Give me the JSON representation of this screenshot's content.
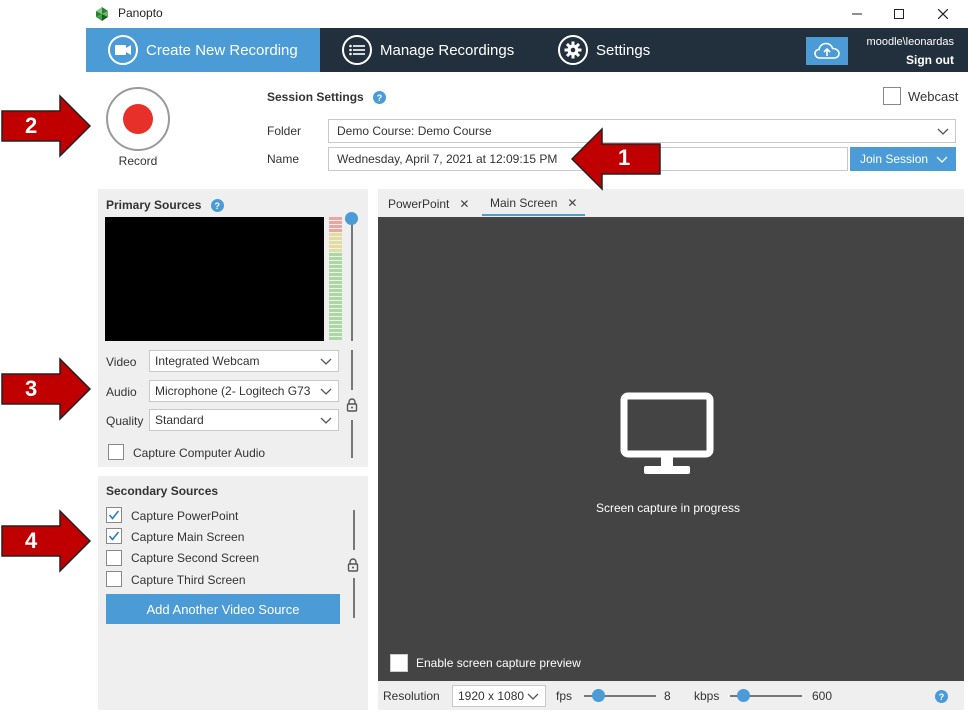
{
  "window": {
    "title": "Panopto"
  },
  "nav": {
    "tabs": [
      {
        "label": "Create New Recording",
        "icon": "video-camera-icon",
        "active": true
      },
      {
        "label": "Manage Recordings",
        "icon": "list-icon",
        "active": false
      },
      {
        "label": "Settings",
        "icon": "gear-icon",
        "active": false
      }
    ],
    "username": "moodle\\leonardas",
    "signout_label": "Sign out"
  },
  "record": {
    "label": "Record"
  },
  "session": {
    "title": "Session Settings",
    "help": "?",
    "webcast_label": "Webcast",
    "webcast_checked": false,
    "folder_label": "Folder",
    "folder_value": "Demo Course: Demo Course",
    "name_label": "Name",
    "name_value": "Wednesday, April 7, 2021 at 12:09:15 PM",
    "join_label": "Join Session"
  },
  "primary": {
    "title": "Primary Sources",
    "help": "?",
    "video_label": "Video",
    "video_value": "Integrated Webcam",
    "audio_label": "Audio",
    "audio_value": "Microphone (2- Logitech G73",
    "quality_label": "Quality",
    "quality_value": "Standard",
    "capture_audio_label": "Capture Computer Audio",
    "capture_audio_checked": false
  },
  "secondary": {
    "title": "Secondary Sources",
    "options": [
      {
        "label": "Capture PowerPoint",
        "checked": true
      },
      {
        "label": "Capture Main Screen",
        "checked": true
      },
      {
        "label": "Capture Second Screen",
        "checked": false
      },
      {
        "label": "Capture Third Screen",
        "checked": false
      }
    ],
    "add_button_label": "Add Another Video Source"
  },
  "source_tabs": [
    {
      "label": "PowerPoint",
      "active": false
    },
    {
      "label": "Main Screen",
      "active": true
    }
  ],
  "capture": {
    "message": "Screen capture in progress",
    "preview_label": "Enable screen capture preview",
    "preview_checked": false
  },
  "bottom": {
    "resolution_label": "Resolution",
    "resolution_value": "1920 x 1080",
    "fps_label": "fps",
    "fps_value": "8",
    "kbps_label": "kbps",
    "kbps_value": "600",
    "help": "?"
  },
  "annotations": [
    "1",
    "2",
    "3",
    "4"
  ],
  "colors": {
    "accent": "#4a9bd6",
    "nav_bg": "#22303e",
    "record": "#e8302a",
    "arrow": "#c00000",
    "capture_bg": "#444444"
  }
}
